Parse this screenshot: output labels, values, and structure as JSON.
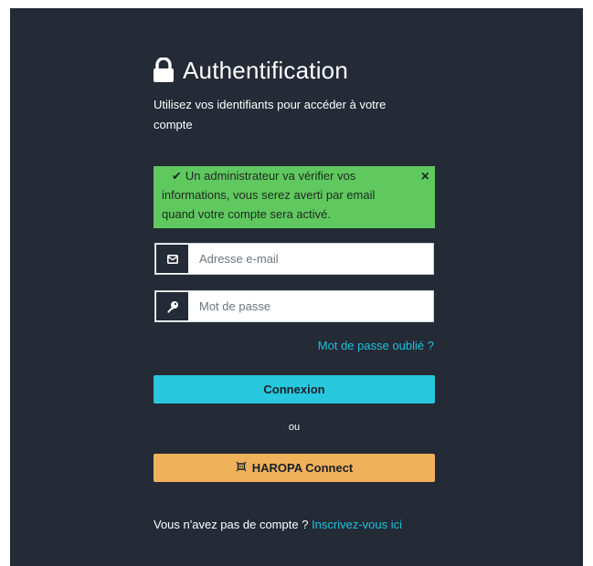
{
  "auth": {
    "title": "Authentification",
    "subtitle": "Utilisez vos identifiants pour accéder à votre compte"
  },
  "alert": {
    "message": "Un administrateur va vérifier vos informations, vous serez averti par email quand votre compte sera activé.",
    "close_label": "×",
    "check_icon": "✔",
    "color": "#5fc95f"
  },
  "form": {
    "email": {
      "placeholder": "Adresse e-mail",
      "value": "",
      "icon": "envelope-icon"
    },
    "password": {
      "placeholder": "Mot de passe",
      "value": "",
      "icon": "key-icon"
    },
    "forgot_label": "Mot de passe oublié ?",
    "submit_label": "Connexion",
    "or_label": "ou",
    "haropa_label": "HAROPA Connect",
    "haropa_icon": "robot-icon"
  },
  "signup": {
    "prompt": "Vous n'avez pas de compte ?",
    "link": "Inscrivez-vous ici"
  },
  "colors": {
    "background": "#242a36",
    "accent": "#28c8de",
    "link": "#1ec1dd",
    "haropa_button": "#efb159"
  }
}
